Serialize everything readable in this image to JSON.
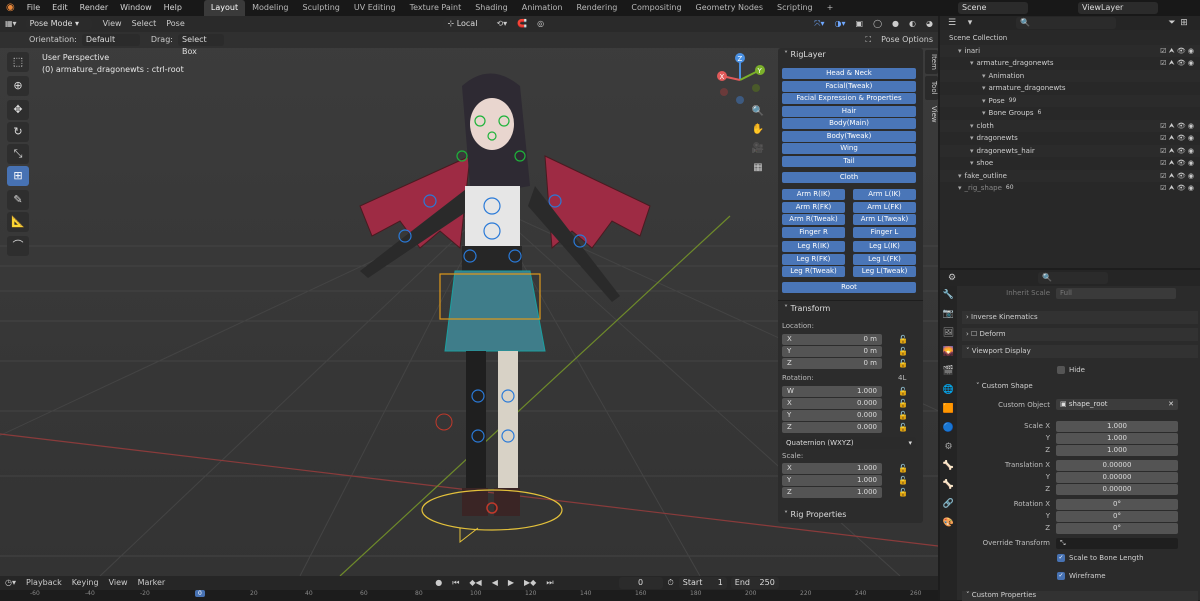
{
  "topbar": {
    "menus": [
      "File",
      "Edit",
      "Render",
      "Window",
      "Help"
    ],
    "workspaces": [
      "Layout",
      "Modeling",
      "Sculpting",
      "UV Editing",
      "Texture Paint",
      "Shading",
      "Animation",
      "Rendering",
      "Compositing",
      "Geometry Nodes",
      "Scripting"
    ],
    "active_workspace": "Layout",
    "scene": "Scene",
    "view_layer": "ViewLayer"
  },
  "viewport_header": {
    "mode": "Pose Mode",
    "menus": [
      "View",
      "Select",
      "Pose"
    ],
    "transform_orientation": "Local",
    "orientation_label": "Orientation:",
    "orientation_value": "Default",
    "drag_label": "Drag:",
    "drag_value": "Select Box",
    "pose_options": "Pose Options"
  },
  "viewport": {
    "perspective": "User Perspective",
    "object_info": "(0) armature_dragonewts : ctrl-root"
  },
  "side_tabs": [
    "Item",
    "Tool",
    "View"
  ],
  "riglayer": {
    "title": "RigLayer",
    "single": [
      "Head & Neck",
      "Facial(Tweak)",
      "Facial Expression & Properties",
      "Hair",
      "Body(Main)",
      "Body(Tweak)",
      "Wing",
      "Tail"
    ],
    "cloth": "Cloth",
    "arm_pairs": [
      [
        "Arm R(IK)",
        "Arm L(IK)"
      ],
      [
        "Arm R(FK)",
        "Arm L(FK)"
      ],
      [
        "Arm R(Tweak)",
        "Arm L(Tweak)"
      ],
      [
        "Finger R",
        "Finger L"
      ]
    ],
    "leg_pairs": [
      [
        "Leg R(IK)",
        "Leg L(IK)"
      ],
      [
        "Leg R(FK)",
        "Leg L(FK)"
      ],
      [
        "Leg R(Tweak)",
        "Leg L(Tweak)"
      ]
    ],
    "root": "Root"
  },
  "transform": {
    "title": "Transform",
    "location_label": "Location:",
    "location": [
      [
        "X",
        "0 m"
      ],
      [
        "Y",
        "0 m"
      ],
      [
        "Z",
        "0 m"
      ]
    ],
    "rotation_label": "Rotation:",
    "rotation_mode_tag": "4L",
    "rotation": [
      [
        "W",
        "1.000"
      ],
      [
        "X",
        "0.000"
      ],
      [
        "Y",
        "0.000"
      ],
      [
        "Z",
        "0.000"
      ]
    ],
    "rotation_mode": "Quaternion (WXYZ)",
    "scale_label": "Scale:",
    "scale": [
      [
        "X",
        "1.000"
      ],
      [
        "Y",
        "1.000"
      ],
      [
        "Z",
        "1.000"
      ]
    ],
    "rig_properties": "Rig Properties"
  },
  "outliner": {
    "rows": [
      {
        "indent": 0,
        "label": "Scene Collection"
      },
      {
        "indent": 1,
        "label": "inari"
      },
      {
        "indent": 2,
        "label": "armature_dragonewts"
      },
      {
        "indent": 3,
        "label": "Animation"
      },
      {
        "indent": 3,
        "label": "armature_dragonewts"
      },
      {
        "indent": 3,
        "label": "Pose",
        "badge": "99"
      },
      {
        "indent": 3,
        "label": "Bone Groups",
        "badge": "6"
      },
      {
        "indent": 2,
        "label": "cloth"
      },
      {
        "indent": 2,
        "label": "dragonewts"
      },
      {
        "indent": 2,
        "label": "dragonewts_hair"
      },
      {
        "indent": 2,
        "label": "shoe"
      },
      {
        "indent": 1,
        "label": "fake_outline"
      },
      {
        "indent": 1,
        "label": "_rig_shape",
        "badge": "60",
        "dim": true
      }
    ]
  },
  "properties": {
    "inherit_scale_label": "Inherit Scale",
    "inherit_scale_value": "Full",
    "sections": [
      "Inverse Kinematics",
      "Deform",
      "Viewport Display"
    ],
    "hide_label": "Hide",
    "custom_shape": "Custom Shape",
    "custom_object_label": "Custom Object",
    "custom_object_value": "shape_root",
    "scale_rows": [
      [
        "Scale X",
        "1.000"
      ],
      [
        "Y",
        "1.000"
      ],
      [
        "Z",
        "1.000"
      ]
    ],
    "translation_rows": [
      [
        "Translation X",
        "0.00000"
      ],
      [
        "Y",
        "0.00000"
      ],
      [
        "Z",
        "0.00000"
      ]
    ],
    "rotation_rows": [
      [
        "Rotation X",
        "0°"
      ],
      [
        "Y",
        "0°"
      ],
      [
        "Z",
        "0°"
      ]
    ],
    "override_transform_label": "Override Transform",
    "scale_to_bone_length": "Scale to Bone Length",
    "wireframe": "Wireframe",
    "custom_properties": "Custom Properties"
  },
  "timeline": {
    "menus": [
      "Playback",
      "Keying",
      "View",
      "Marker"
    ],
    "current_frame": "0",
    "start_label": "Start",
    "start": "1",
    "end_label": "End",
    "end": "250",
    "ruler": [
      "-60",
      "-40",
      "-20",
      "0",
      "20",
      "40",
      "60",
      "80",
      "100",
      "120",
      "140",
      "160",
      "180",
      "200",
      "220",
      "240",
      "260"
    ],
    "playhead": "0"
  },
  "colors": {
    "accent": "#4772b3",
    "rig_button": "#4a76b8",
    "bone_select": "#e09a1a"
  }
}
